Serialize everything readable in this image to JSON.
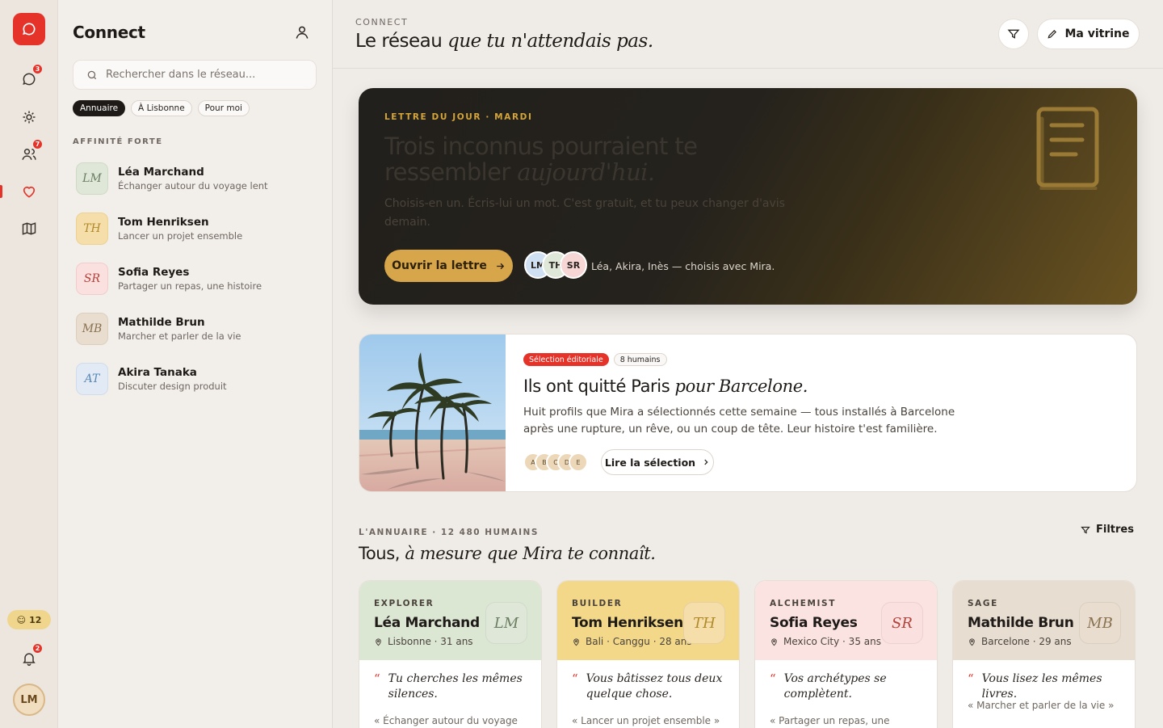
{
  "rail": {
    "messages_badge": "3",
    "people_badge": "7",
    "notifications_badge": "2",
    "coins": "12",
    "user_initials": "LM"
  },
  "sidebar": {
    "title": "Connect",
    "search_placeholder": "Rechercher dans le réseau...",
    "chips": [
      "Annuaire",
      "À Lisbonne",
      "Pour moi"
    ],
    "section": "AFFINITÉ FORTE",
    "people": [
      {
        "initials": "LM",
        "name": "Léa Marchand",
        "sub": "Échanger autour du voyage lent",
        "color": "#dfe8d8",
        "fg": "#6b7d61"
      },
      {
        "initials": "TH",
        "name": "Tom Henriksen",
        "sub": "Lancer un projet ensemble",
        "color": "#f5deaa",
        "fg": "#b08a2a"
      },
      {
        "initials": "SR",
        "name": "Sofia Reyes",
        "sub": "Partager un repas, une histoire",
        "color": "#fbe0e0",
        "fg": "#b2433b"
      },
      {
        "initials": "MB",
        "name": "Mathilde Brun",
        "sub": "Marcher et parler de la vie",
        "color": "#e8ddcf",
        "fg": "#8a7250"
      },
      {
        "initials": "AT",
        "name": "Akira Tanaka",
        "sub": "Discuter design produit",
        "color": "#e2ebf5",
        "fg": "#5b88b5"
      }
    ]
  },
  "header": {
    "kicker": "CONNECT",
    "title_plain": "Le réseau",
    "title_italic": "que tu n'attendais pas.",
    "vitrine_label": "Ma vitrine"
  },
  "letter": {
    "kicker": "LETTRE DU JOUR · MARDI",
    "title_plain": "Trois inconnus pourraient te ressembler",
    "title_italic": "aujourd'hui.",
    "desc": "Choisis-en un. Écris-lui un mot. C'est gratuit, et tu peux changer d'avis demain.",
    "cta": "Ouvrir la lettre",
    "avatars": [
      "LM",
      "TH",
      "SR"
    ],
    "chosen": "Léa, Akira, Inès — choisis avec Mira."
  },
  "editorial": {
    "tag_primary": "Sélection éditoriale",
    "tag_count": "8 humains",
    "title_plain": "Ils ont quitté Paris",
    "title_italic": "pour Barcelone.",
    "desc": "Huit profils que Mira a sélectionnés cette semaine — tous installés à Barcelone après une rupture, un rêve, ou un coup de tête. Leur histoire t'est familière.",
    "minis": [
      "A",
      "B",
      "C",
      "D",
      "E"
    ],
    "cta": "Lire la sélection"
  },
  "directory": {
    "kicker": "L'ANNUAIRE · 12 480 HUMAINS",
    "title_plain": "Tous,",
    "title_italic": "à mesure que Mira te connaît.",
    "filters_label": "Filtres",
    "cards": [
      {
        "archetype": "EXPLORER",
        "name": "Léa Marchand",
        "location": "Lisbonne · 31 ans",
        "initials": "LM",
        "quote": "Tu cherches les mêmes silences.",
        "sub": "« Échanger autour du voyage",
        "bg": "#dbe6d3",
        "fg": "#6b7d61"
      },
      {
        "archetype": "BUILDER",
        "name": "Tom Henriksen",
        "location": "Bali · Canggu · 28 ans",
        "initials": "TH",
        "quote": "Vous bâtissez tous deux quelque chose.",
        "sub": "« Lancer un projet ensemble »",
        "bg": "#f3d889",
        "fg": "#b08a2a"
      },
      {
        "archetype": "ALCHEMIST",
        "name": "Sofia Reyes",
        "location": "Mexico City · 35 ans",
        "initials": "SR",
        "quote": "Vos archétypes se complètent.",
        "sub": "« Partager un repas, une",
        "bg": "#fbe3e1",
        "fg": "#b2433b"
      },
      {
        "archetype": "SAGE",
        "name": "Mathilde Brun",
        "location": "Barcelone · 29 ans",
        "initials": "MB",
        "quote": "Vous lisez les mêmes livres.",
        "sub": "« Marcher et parler de la vie »",
        "bg": "#e7ddd0",
        "fg": "#8a7250"
      }
    ]
  }
}
